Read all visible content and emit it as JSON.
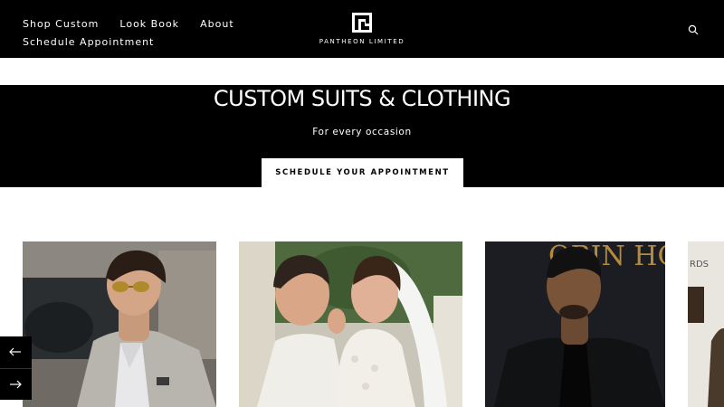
{
  "header": {
    "nav": [
      {
        "label": "Shop Custom"
      },
      {
        "label": "Look Book"
      },
      {
        "label": "About"
      },
      {
        "label": "Schedule Appointment"
      }
    ],
    "logo_text": "PANTHEON LIMITED",
    "search_icon": "search-icon"
  },
  "hero": {
    "title": "CUSTOM SUITS & CLOTHING",
    "subtitle": "For every occasion",
    "cta_label": "SCHEDULE YOUR APPOINTMENT"
  },
  "gallery": {
    "cards": [
      {
        "image": "man-in-grey-suit-with-sunglasses"
      },
      {
        "image": "groom-in-white-and-bride-in-lace-dress"
      },
      {
        "image": "man-in-black-suit-at-premiere",
        "backdrop_text": "OBIN HOOD"
      },
      {
        "image": "man-at-awards-event",
        "backdrop_text": "RDS"
      }
    ],
    "prev_icon": "arrow-left-icon",
    "next_icon": "arrow-right-icon"
  },
  "colors": {
    "header_bg": "#000000",
    "hero_bg": "#000000",
    "button_bg": "#ffffff",
    "text_light": "#ffffff"
  }
}
